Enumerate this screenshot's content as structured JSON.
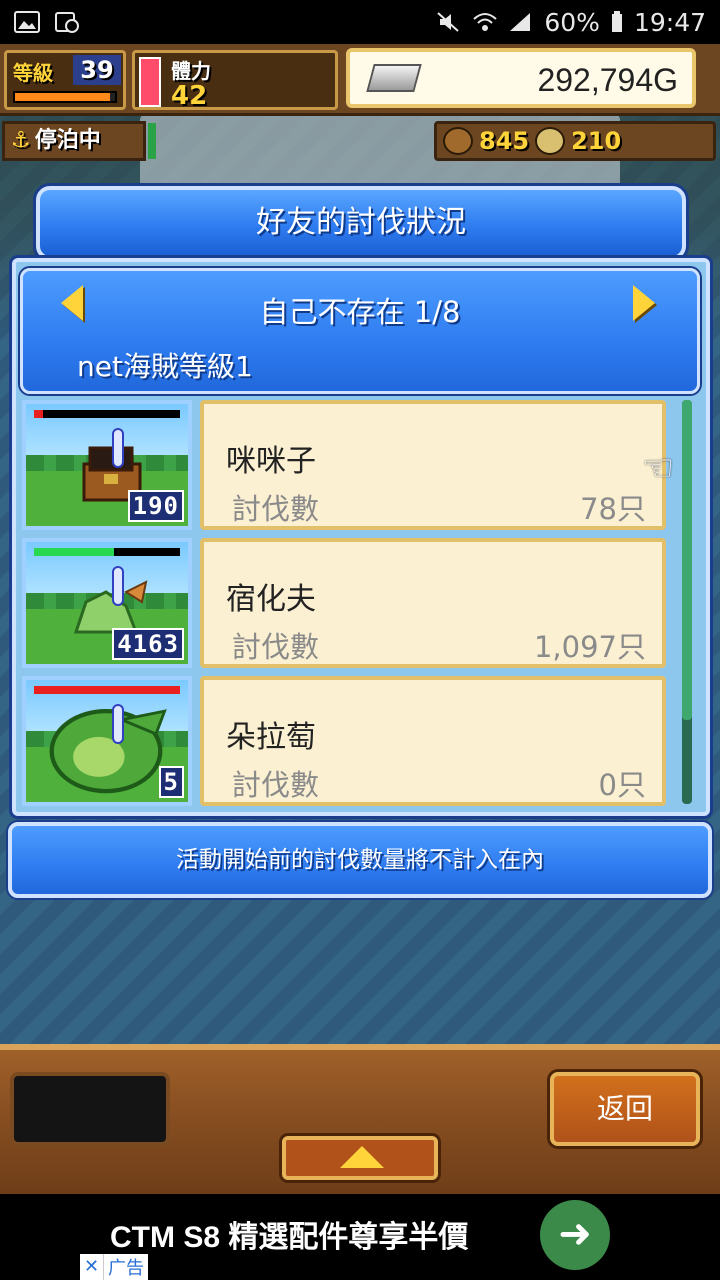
{
  "status_bar": {
    "battery": "60%",
    "time": "19:47",
    "icons": [
      "image-icon",
      "alarm-icon",
      "mute-icon",
      "wifi-icon",
      "signal-icon",
      "battery-icon"
    ]
  },
  "hud": {
    "level_label": "等級",
    "level_value": "39",
    "level_progress": 0.95,
    "stamina_label": "體力",
    "stamina_value": "42",
    "gold_value": "292,794G",
    "dock_status": "停泊中",
    "wood_value": "845",
    "coin_value": "210"
  },
  "dialog": {
    "title": "好友的討伐狀況",
    "friend_title": "自己不存在 1/8",
    "friend_sub": "net海賊等級1",
    "rows": [
      {
        "name": "咪咪子",
        "label": "討伐數",
        "value": "78只",
        "badge": "190",
        "hp": 0.06,
        "hp_color": "#e82020"
      },
      {
        "name": "宿化夫",
        "label": "討伐數",
        "value": "1,097只",
        "badge": "4163",
        "hp": 0.55,
        "hp_color": "#28d850"
      },
      {
        "name": "朵拉萄",
        "label": "討伐數",
        "value": "0只",
        "badge": "5",
        "hp": 1.0,
        "hp_color": "#e82020"
      }
    ],
    "footer_note": "活動開始前的討伐數量將不計入在內"
  },
  "bottom": {
    "back_label": "返回"
  },
  "ad": {
    "text": "CTM S8 精選配件尊享半價",
    "tag": "广告",
    "close": "✕"
  },
  "colors": {
    "accent_blue": "#2e7cf0",
    "card_bg": "#fbf0d2",
    "gold_border": "#e2c06a"
  }
}
